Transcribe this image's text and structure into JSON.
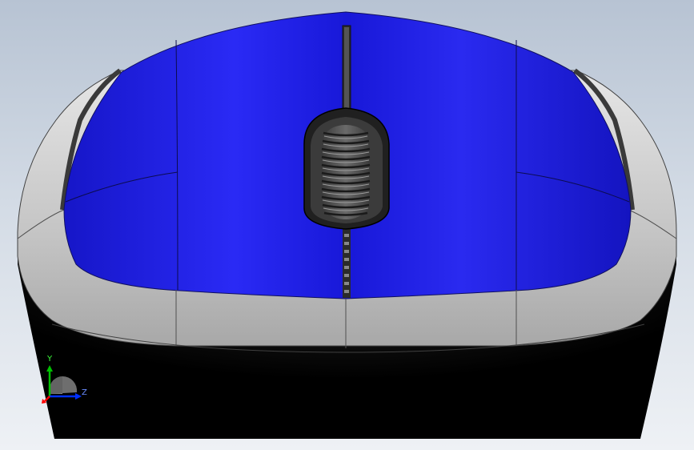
{
  "triad": {
    "y_label": "Y",
    "z_label": "Z",
    "colors": {
      "y_axis": "#00c000",
      "z_axis": "#0030ff",
      "x_axis": "#ff0000"
    }
  },
  "model": {
    "colors": {
      "shell_top": "#1e1ee6",
      "shell_grip": "#c8c8c8",
      "base": "#000000",
      "background_top": "#b7c3d3",
      "background_bottom": "#eef1f5"
    },
    "icons": [
      "scroll-wheel-icon"
    ]
  }
}
